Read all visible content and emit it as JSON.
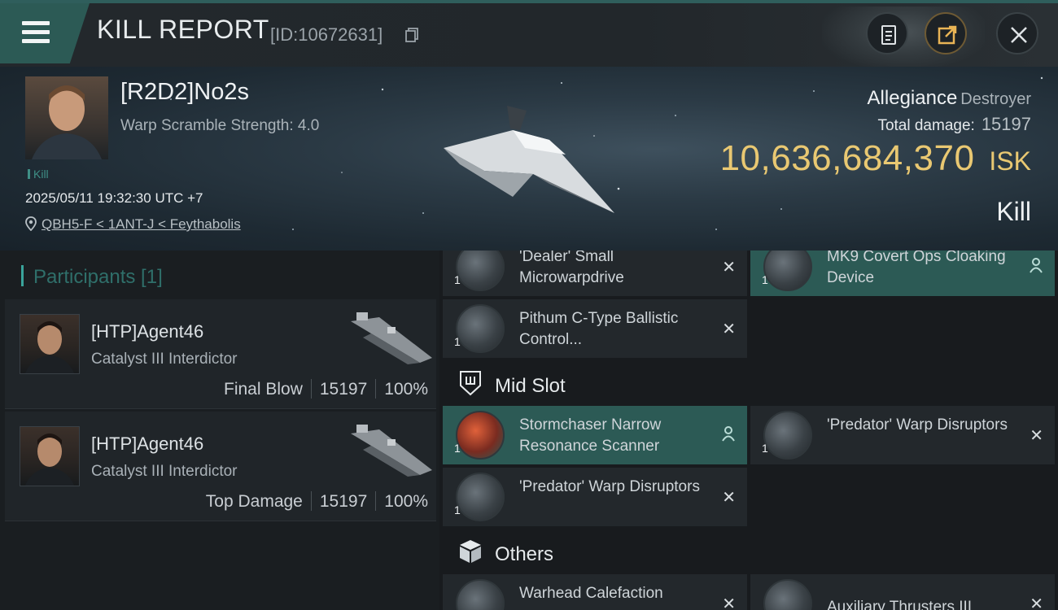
{
  "header": {
    "title": "KILL REPORT",
    "report_id": "[ID:10672631]",
    "icons": [
      "menu-icon",
      "copy-icon",
      "clipboard-icon",
      "share-icon",
      "close-icon"
    ]
  },
  "victim": {
    "pilot_name": "[R2D2]No2s",
    "warp_scramble": "Warp Scramble Strength: 4.0",
    "tag": "Kill",
    "datetime": "2025/05/11 19:32:30 UTC +7",
    "location": "QBH5-F < 1ANT-J < Feythabolis",
    "ship_name": "Allegiance",
    "ship_class": "Destroyer",
    "total_damage_label": "Total damage:",
    "total_damage": "15197",
    "isk_value": "10,636,684,370",
    "isk_unit": "ISK",
    "result": "Kill"
  },
  "participants": {
    "heading": "Participants [1]",
    "items": [
      {
        "name": "[HTP]Agent46",
        "ship": "Catalyst III Interdictor",
        "role": "Final Blow",
        "damage": "15197",
        "percent": "100%"
      },
      {
        "name": "[HTP]Agent46",
        "ship": "Catalyst III Interdictor",
        "role": "Top Damage",
        "damage": "15197",
        "percent": "100%"
      }
    ]
  },
  "fitting": {
    "low_slots": [
      {
        "name": "'Dealer' Small Microwarpdrive",
        "qty": "1",
        "status": "destroyed"
      },
      {
        "name": "MK9 Covert Ops Cloaking Device",
        "qty": "1",
        "status": "dropped"
      },
      {
        "name": "Pithum C-Type Ballistic Control...",
        "qty": "1",
        "status": "destroyed"
      }
    ],
    "mid_heading": "Mid Slot",
    "mid_slots": [
      {
        "name": "Stormchaser Narrow Resonance Scanner",
        "qty": "1",
        "status": "dropped"
      },
      {
        "name": "'Predator' Warp Disruptors",
        "qty": "1",
        "status": "destroyed"
      },
      {
        "name": "'Predator' Warp Disruptors",
        "qty": "1",
        "status": "destroyed"
      }
    ],
    "others_heading": "Others",
    "others": [
      {
        "name": "Warhead Calefaction",
        "qty": "1",
        "status": "destroyed"
      },
      {
        "name": "Auxiliary Thrusters III",
        "qty": "1",
        "status": "destroyed"
      }
    ]
  },
  "colors": {
    "accent": "#2c5a55",
    "isk_gold": "#e9c872",
    "panel": "#23282c"
  }
}
